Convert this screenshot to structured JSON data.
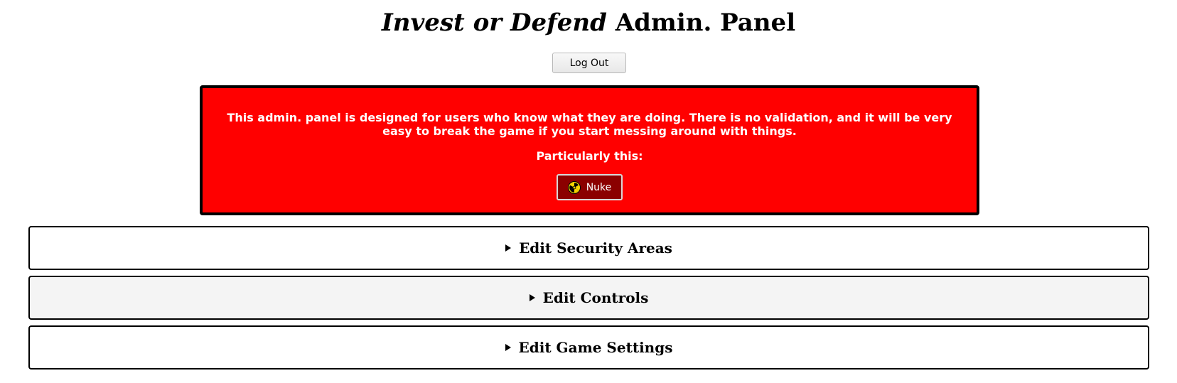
{
  "header": {
    "title_italic": "Invest or Defend",
    "title_rest": "Admin. Panel"
  },
  "logout_label": "Log Out",
  "warning": {
    "message": "This admin. panel is designed for users who know what they are doing. There is no validation, and it will be very easy to break the game if you start messing around with things.",
    "particularly": "Particularly this:",
    "nuke_label": "Nuke",
    "nuke_icon": "radiation-icon",
    "background_color": "#ff0000",
    "nuke_button_color": "#8b0000"
  },
  "sections": [
    {
      "label": "Edit Security Areas",
      "icon": "triangle-right-icon"
    },
    {
      "label": "Edit Controls",
      "icon": "triangle-right-icon"
    },
    {
      "label": "Edit Game Settings",
      "icon": "triangle-right-icon"
    }
  ]
}
